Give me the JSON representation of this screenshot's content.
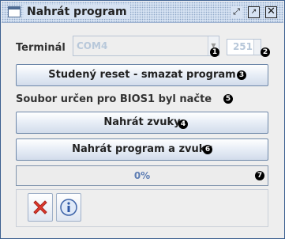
{
  "window": {
    "title": "Nahrát program"
  },
  "terminal": {
    "label": "Terminál",
    "combo_value": "COM4",
    "spinner_value": "251"
  },
  "badges": {
    "b1": "1",
    "b2": "2",
    "b3": "3",
    "b4": "4",
    "b5": "5",
    "b6": "6",
    "b7": "7"
  },
  "buttons": {
    "cold_reset": "Studený reset - smazat program",
    "upload_sounds": "Nahrát zvuky",
    "upload_program_and_sounds": "Nahrát program a zvuky"
  },
  "status": {
    "text": "Soubor určen pro BIOS1 byl načte"
  },
  "progress": {
    "percent": 0,
    "label": "0%"
  },
  "colors": {
    "accent": "#7e9fd0",
    "badge": "#000000"
  },
  "icons": [
    "window-icon",
    "restore-icon",
    "maximize-icon",
    "close-icon",
    "cancel-icon",
    "info-icon",
    "dropdown-arrow-icon"
  ]
}
